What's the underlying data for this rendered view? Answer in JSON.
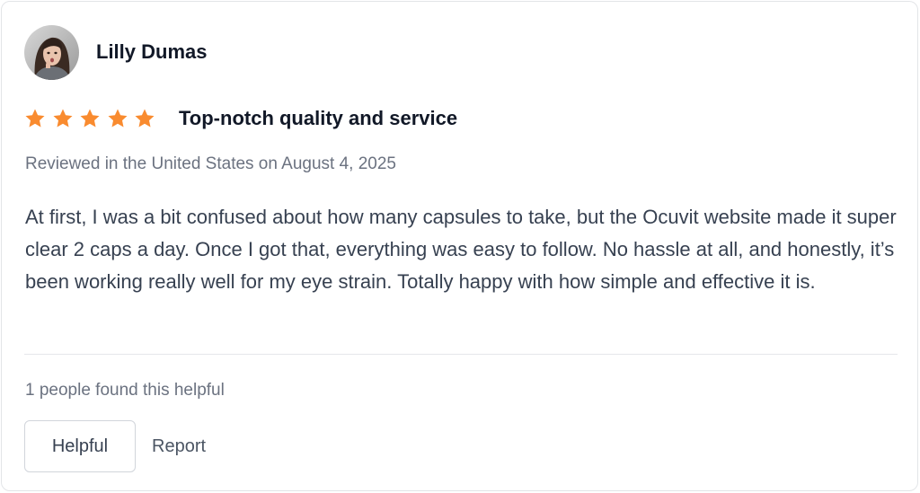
{
  "review": {
    "author": {
      "name": "Lilly Dumas",
      "avatar_icon": "user-avatar-photo"
    },
    "rating": {
      "stars": 5,
      "max": 5,
      "star_icon": "star-icon",
      "color": "#f98b2f"
    },
    "title": "Top-notch quality and service",
    "meta": "Reviewed in the United States on August 4, 2025",
    "body": "At first, I was a bit confused about how many capsules to take, but the Ocuvit website made it super clear 2 caps a day. Once I got that, everything was easy to follow. No hassle at all, and honestly, it’s been working really well for my eye strain. Totally happy with how simple and effective it is.",
    "helpful_count_text": "1 people found this helpful",
    "actions": {
      "helpful_label": "Helpful",
      "report_label": "Report"
    }
  }
}
